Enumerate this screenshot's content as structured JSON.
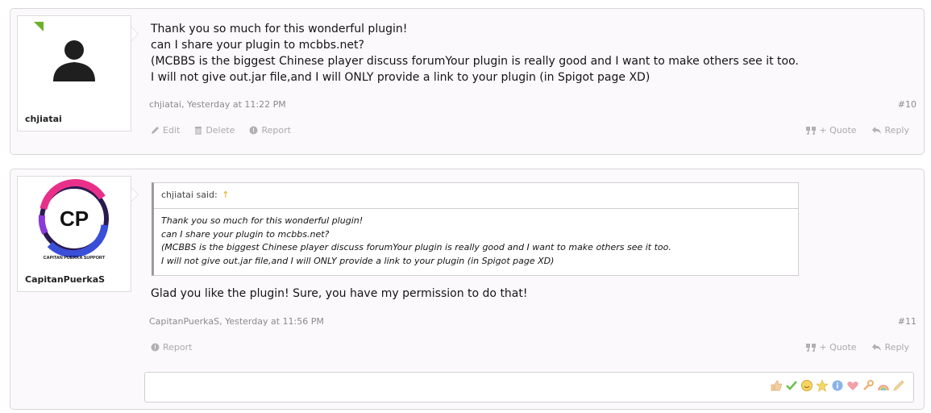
{
  "posts": [
    {
      "username": "chjiatai",
      "lines": [
        "Thank you so much for this wonderful plugin!",
        "can I share your plugin to mcbbs.net?",
        "(MCBBS is the biggest Chinese player discuss forumYour plugin is really good and I want to make others see it too.",
        "I will not give out.jar file,and I will ONLY provide a link to your plugin (in Spigot page XD)"
      ],
      "meta": "chjiatai, Yesterday at 11:22 PM",
      "number": "#10",
      "actions": {
        "edit": "Edit",
        "delete": "Delete",
        "report": "Report",
        "quote": "+ Quote",
        "reply": "Reply"
      }
    },
    {
      "username": "CapitanPuerkaS",
      "avatar_text": "CP",
      "avatar_caption": "CAPITAN PUERKA SUPPORT",
      "quote": {
        "header": "chjiatai said:",
        "arrow": "↑",
        "lines": [
          "Thank you so much for this wonderful plugin!",
          "can I share your plugin to mcbbs.net?",
          "(MCBBS is the biggest Chinese player discuss forumYour plugin is really good and I want to make others see it too.",
          "I will not give out.jar file,and I will ONLY provide a link to your plugin (in Spigot page XD)"
        ]
      },
      "message": "Glad you like the plugin! Sure, you have my permission to do that!",
      "meta": "CapitanPuerkaS, Yesterday at 11:56 PM",
      "number": "#11",
      "actions": {
        "report": "Report",
        "quote": "+ Quote",
        "reply": "Reply"
      }
    }
  ],
  "reply_box": {
    "rating_icons": [
      "thumbs-up-icon",
      "check-icon",
      "smile-icon",
      "star-icon",
      "info-icon",
      "heart-icon",
      "wrench-icon",
      "rainbow-icon",
      "pencil-icon"
    ]
  },
  "colors": {
    "online": "#6cb02b",
    "quote_arrow": "#e6a817",
    "muted": "#8a8a8a",
    "action": "#aaaaaa"
  }
}
